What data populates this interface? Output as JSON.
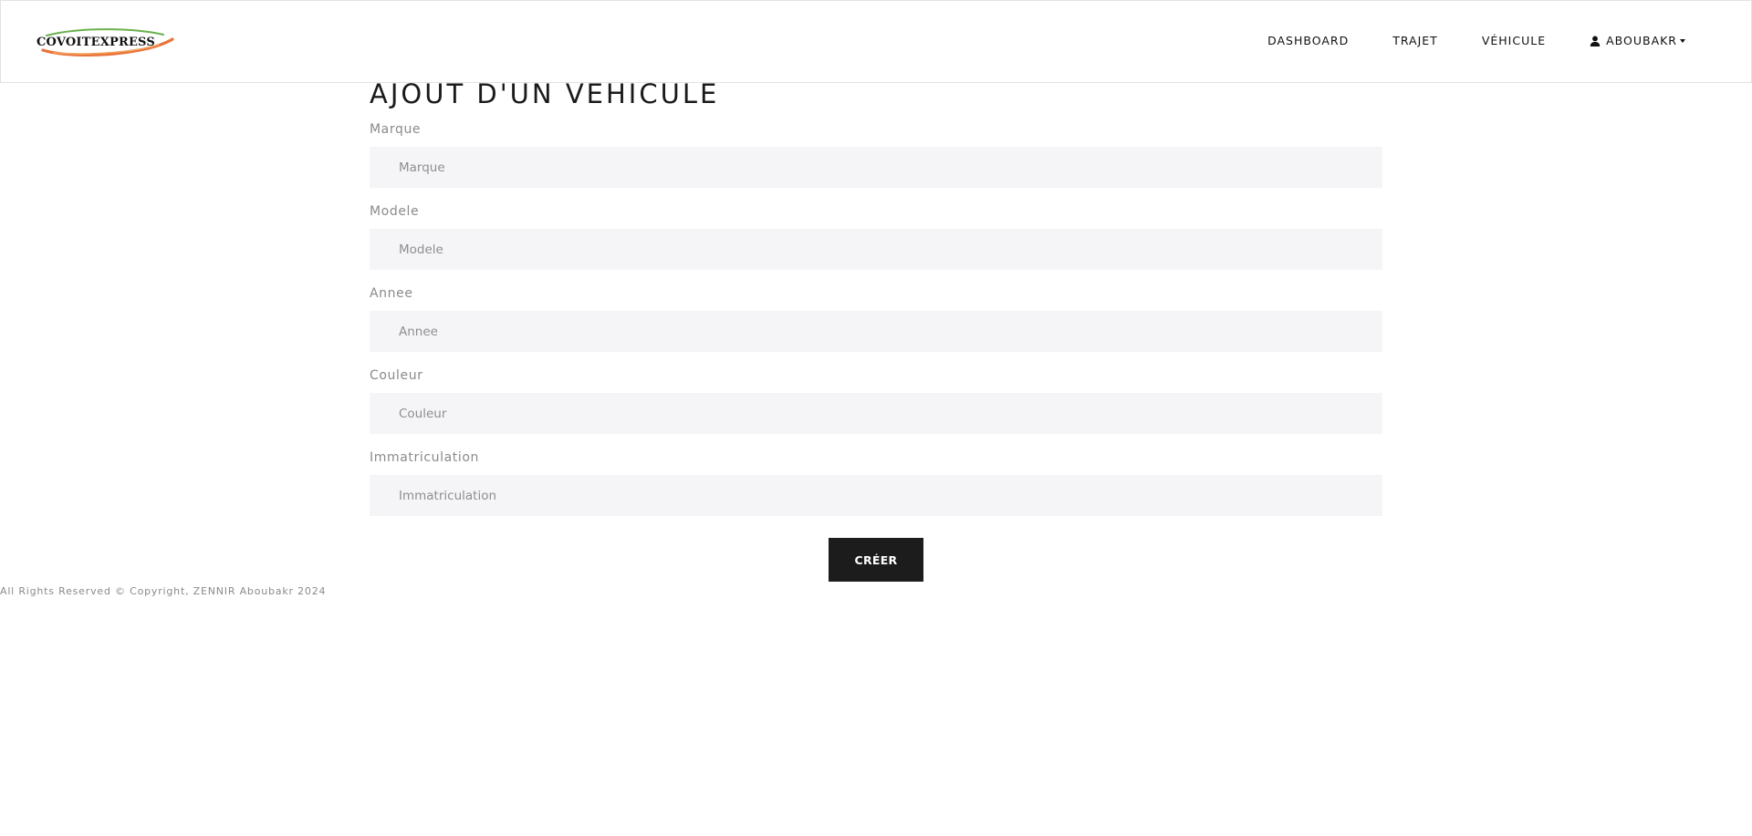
{
  "brand": {
    "logo_text": "COVOITEXPRESS",
    "swoosh_colors": [
      "#e8743b",
      "#f4a15d",
      "#6ab04c"
    ]
  },
  "nav": {
    "links": [
      {
        "label": "DASHBOARD"
      },
      {
        "label": "TRAJET"
      },
      {
        "label": "VÉHICULE"
      }
    ],
    "user": {
      "label": "ABOUBAKR",
      "icon": "user-icon"
    }
  },
  "page": {
    "title": "AJOUT D'UN VEHICULE"
  },
  "form": {
    "fields": [
      {
        "label": "Marque",
        "placeholder": "Marque",
        "value": ""
      },
      {
        "label": "Modele",
        "placeholder": "Modele",
        "value": ""
      },
      {
        "label": "Annee",
        "placeholder": "Annee",
        "value": ""
      },
      {
        "label": "Couleur",
        "placeholder": "Couleur",
        "value": ""
      },
      {
        "label": "Immatriculation",
        "placeholder": "Immatriculation",
        "value": ""
      }
    ],
    "submit_label": "CRÉER"
  },
  "footer": {
    "text": "All Rights Reserved © Copyright, ZENNIR Aboubakr 2024"
  }
}
